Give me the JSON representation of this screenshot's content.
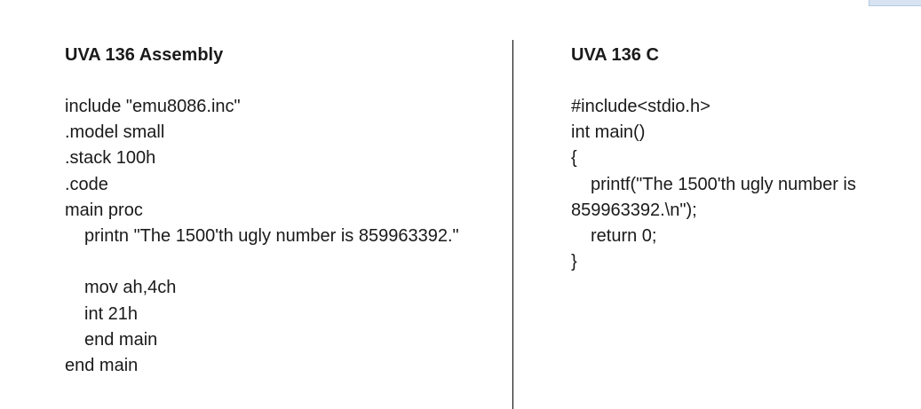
{
  "left_column": {
    "title": "UVA 136 Assembly",
    "lines": [
      "include \"emu8086.inc\"",
      ".model small",
      ".stack 100h",
      ".code",
      "main proc",
      "printn \"The 1500'th ugly number is 859963392.\"",
      "",
      "mov ah,4ch",
      "int 21h",
      "end main",
      "end main"
    ]
  },
  "right_column": {
    "title": "UVA 136 C",
    "lines": [
      "#include<stdio.h>",
      "int main()",
      "{",
      "printf(\"The 1500'th ugly number is 859963392.\\n\");",
      "return 0;",
      "}"
    ]
  }
}
